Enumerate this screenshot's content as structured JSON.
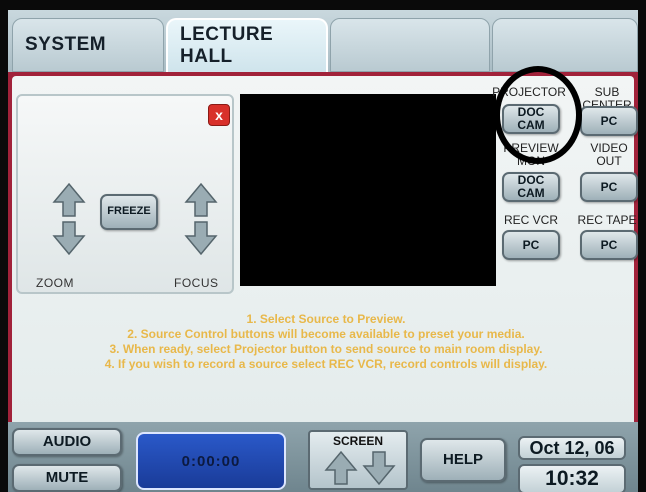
{
  "tabs": {
    "system": "SYSTEM",
    "lecture_hall": "LECTURE HALL",
    "blank1": "",
    "blank2": ""
  },
  "camera": {
    "close": "x",
    "freeze": "FREEZE",
    "zoom": "ZOOM",
    "focus": "FOCUS"
  },
  "routing": {
    "projector": {
      "label": "PROJECTOR",
      "button": "DOC CAM"
    },
    "sub_center": {
      "label": "SUB CENTER",
      "button": "PC"
    },
    "preview_mon": {
      "label": "PREVIEW MON",
      "button": "DOC CAM"
    },
    "video_out": {
      "label": "VIDEO OUT",
      "button": "PC"
    },
    "rec_vcr": {
      "label": "REC VCR",
      "button": "PC"
    },
    "rec_tape": {
      "label": "REC TAPE",
      "button": "PC"
    }
  },
  "instructions": [
    "1. Select Source to Preview.",
    "2. Source Control buttons will become available to preset your media.",
    "3. When ready, select Projector button to send source to main room display.",
    "4. If you wish to record a source select REC VCR, record controls will display."
  ],
  "bottom": {
    "audio": "AUDIO",
    "mute": "MUTE",
    "timer": "0:00:00",
    "screen": "SCREEN",
    "help": "HELP",
    "date": "Oct 12, 06",
    "time": "10:32"
  },
  "icons": {
    "up": "arrow-up-icon",
    "down": "arrow-down-icon"
  },
  "colors": {
    "panel_border": "#a1223a",
    "instruction_text": "#e8b84a",
    "timer_bg": "#2a59c9"
  }
}
